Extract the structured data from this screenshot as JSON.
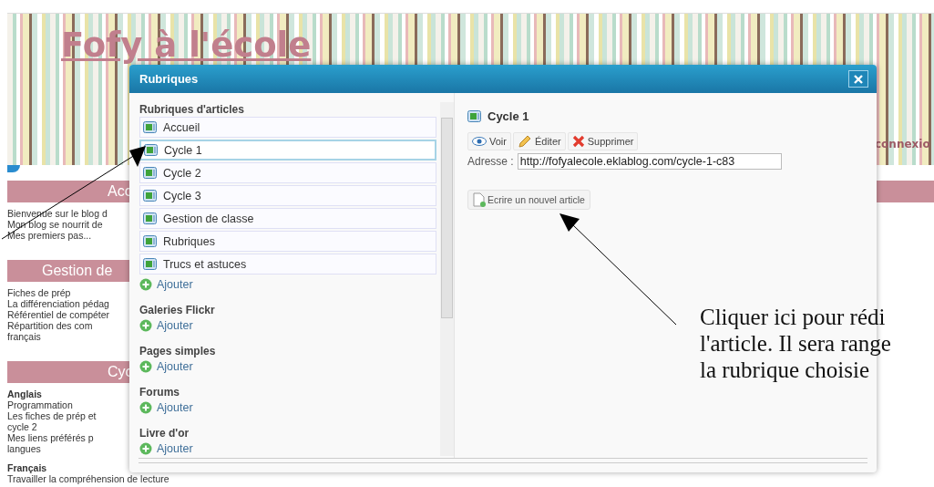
{
  "blog": {
    "title": "Fofy à l'école",
    "login_link": "connexio"
  },
  "sidebar": [
    {
      "heading": "Acc",
      "lines": [
        {
          "text": "Bienvenue sur le blog d",
          "kind": "plain"
        },
        {
          "text": "Mon blog se nourrit de",
          "kind": "plain"
        },
        {
          "text": "Mes premiers pas...",
          "kind": "plain"
        }
      ]
    },
    {
      "heading": "Gestion de",
      "lines": [
        {
          "text": "Fiches de prép",
          "kind": "plain"
        },
        {
          "text": "La différenciation pédag",
          "kind": "plain"
        },
        {
          "text": "Référentiel de compéter",
          "kind": "plain"
        },
        {
          "text": "Répartition   des   com",
          "kind": "plain"
        },
        {
          "text": "français",
          "kind": "plain"
        }
      ]
    },
    {
      "heading": "Cyc",
      "lines": [
        {
          "text": "Anglais",
          "kind": "bold"
        },
        {
          "text": "Programmation",
          "kind": "plain"
        },
        {
          "text": "Les fiches de prép et",
          "kind": "plain"
        },
        {
          "text": "cycle 2",
          "kind": "plain"
        },
        {
          "text": "Mes liens préférés p",
          "kind": "plain"
        },
        {
          "text": "langues",
          "kind": "plain"
        },
        {
          "text": "Français",
          "kind": "bold"
        },
        {
          "text": "Travailler la compréhension de lecture",
          "kind": "plain"
        }
      ]
    }
  ],
  "dialog": {
    "title": "Rubriques",
    "groups": [
      {
        "heading": "Rubriques d'articles",
        "items": [
          {
            "label": "Accueil",
            "selected": false
          },
          {
            "label": "Cycle 1",
            "selected": true
          },
          {
            "label": "Cycle 2",
            "selected": false
          },
          {
            "label": "Cycle 3",
            "selected": false
          },
          {
            "label": "Gestion de classe",
            "selected": false
          },
          {
            "label": "Rubriques",
            "selected": false
          },
          {
            "label": "Trucs et astuces",
            "selected": false
          }
        ],
        "add_label": "Ajouter"
      },
      {
        "heading": "Galeries Flickr",
        "add_label": "Ajouter"
      },
      {
        "heading": "Pages simples",
        "add_label": "Ajouter"
      },
      {
        "heading": "Forums",
        "add_label": "Ajouter"
      },
      {
        "heading": "Livre d'or",
        "add_label": "Ajouter"
      }
    ],
    "detail": {
      "title": "Cycle 1",
      "actions": [
        {
          "label": "Voir",
          "kind": "view"
        },
        {
          "label": "Éditer",
          "kind": "edit"
        },
        {
          "label": "Supprimer",
          "kind": "delete"
        }
      ],
      "address_label": "Adresse :",
      "address_value": "http://fofyalecole.eklablog.com/cycle-1-c83",
      "new_article": "Ecrire un nouvel article"
    }
  },
  "annotation": {
    "lines": [
      "Cliquer ici pour rédi",
      "l'article. Il sera range",
      "la rubrique choisie"
    ]
  }
}
